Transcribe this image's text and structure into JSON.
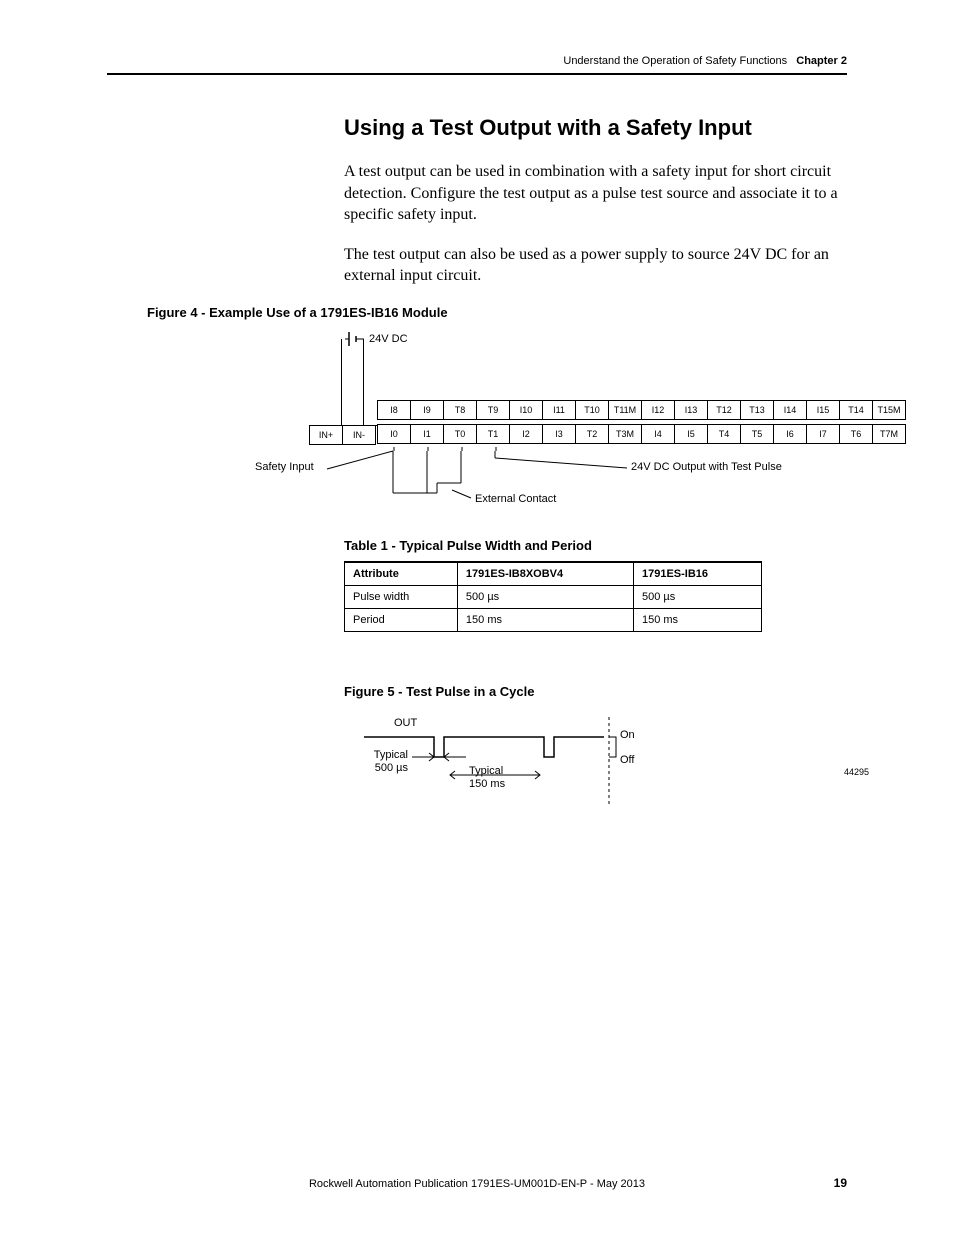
{
  "header": {
    "title": "Understand the Operation of Safety Functions",
    "chapter": "Chapter 2"
  },
  "section": {
    "title": "Using a Test Output with a Safety Input",
    "para1": "A test output can be used in combination with a safety input for short circuit detection. Configure the test output as a pulse test source and associate it to a specific safety input.",
    "para2": "The test output can also be used as a power supply to source 24V DC for an external input circuit."
  },
  "figure4": {
    "title": "Figure 4 - Example Use of a 1791ES-IB16 Module",
    "dc_label": "24V DC",
    "in_plus": "IN+",
    "in_minus": "IN-",
    "row_top": [
      "I8",
      "I9",
      "T8",
      "T9",
      "I10",
      "I11",
      "T10",
      "T11M",
      "I12",
      "I13",
      "T12",
      "T13",
      "I14",
      "I15",
      "T14",
      "T15M"
    ],
    "row_bot": [
      "I0",
      "I1",
      "T0",
      "T1",
      "I2",
      "I3",
      "T2",
      "T3M",
      "I4",
      "I5",
      "T4",
      "T5",
      "I6",
      "I7",
      "T6",
      "T7M"
    ],
    "ann_safety_input": "Safety Input",
    "ann_ext_contact": "External Contact",
    "ann_dc_pulse": "24V DC Output with Test Pulse"
  },
  "table1": {
    "title": "Table 1 - Typical Pulse Width and Period",
    "headers": [
      "Attribute",
      "1791ES-IB8XOBV4",
      "1791ES-IB16"
    ],
    "rows": [
      [
        "Pulse width",
        "500 µs",
        "500 µs"
      ],
      [
        "Period",
        "150 ms",
        "150 ms"
      ]
    ]
  },
  "figure5": {
    "title": "Figure 5 - Test Pulse in a Cycle",
    "out": "OUT",
    "typical_width_l1": "Typical",
    "typical_width_l2": "500 µs",
    "typical_period_l1": "Typical",
    "typical_period_l2": "150 ms",
    "on": "On",
    "off": "Off",
    "ref": "44295"
  },
  "footer": {
    "pub": "Rockwell Automation Publication 1791ES-UM001D-EN-P - May 2013",
    "page": "19"
  },
  "chart_data": [
    {
      "type": "table",
      "title": "Typical Pulse Width and Period",
      "columns": [
        "Attribute",
        "1791ES-IB8XOBV4",
        "1791ES-IB16"
      ],
      "rows": [
        [
          "Pulse width",
          "500 µs",
          "500 µs"
        ],
        [
          "Period",
          "150 ms",
          "150 ms"
        ]
      ]
    },
    {
      "type": "timing-diagram",
      "title": "Test Pulse in a Cycle",
      "signal": "OUT",
      "levels": [
        "On",
        "Off"
      ],
      "pulse_width": "500 µs",
      "period": "150 ms"
    }
  ]
}
